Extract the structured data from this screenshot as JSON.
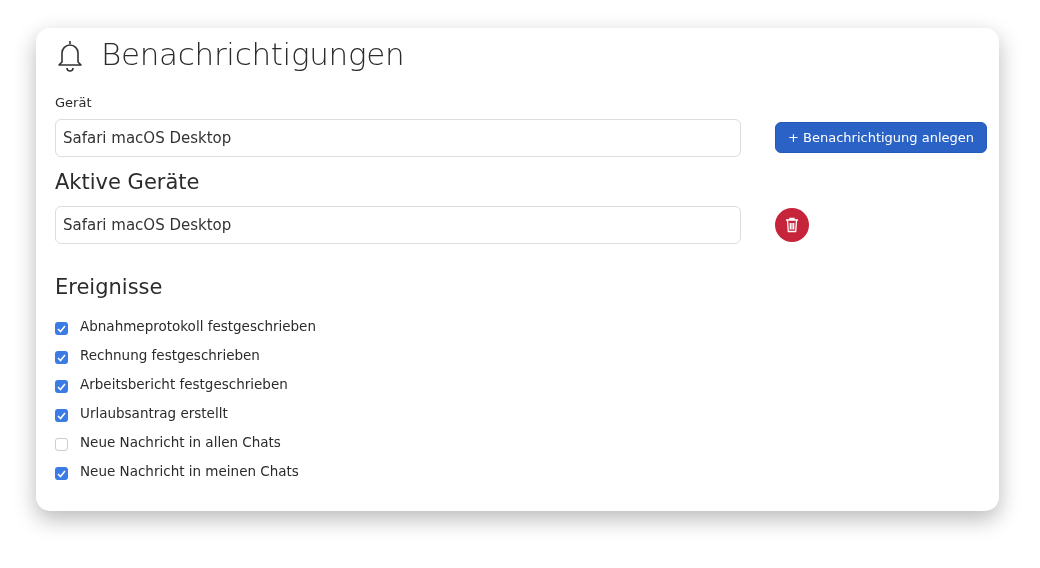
{
  "title": "Benachrichtigungen",
  "device": {
    "label": "Gerät",
    "value": "Safari macOS Desktop"
  },
  "add_button": {
    "label": "+ Benachrichtigung anlegen"
  },
  "active_devices": {
    "heading": "Aktive Geräte",
    "items": [
      {
        "value": "Safari macOS Desktop"
      }
    ]
  },
  "events": {
    "heading": "Ereignisse",
    "items": [
      {
        "label": "Abnahmeprotokoll festgeschrieben",
        "checked": true
      },
      {
        "label": "Rechnung festgeschrieben",
        "checked": true
      },
      {
        "label": "Arbeitsbericht festgeschrieben",
        "checked": true
      },
      {
        "label": "Urlaubsantrag erstellt",
        "checked": true
      },
      {
        "label": "Neue Nachricht in allen Chats",
        "checked": false
      },
      {
        "label": "Neue Nachricht in meinen Chats",
        "checked": true
      }
    ]
  }
}
